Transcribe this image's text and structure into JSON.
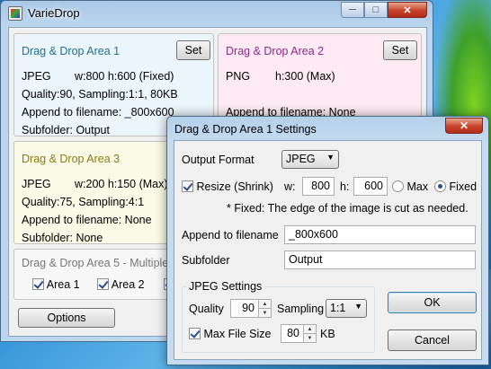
{
  "main_window": {
    "title": "VarieDrop",
    "caption": {
      "minimize": "─",
      "maximize": "□",
      "close": "✕"
    },
    "areas": {
      "area1": {
        "title": "Drag & Drop Area 1",
        "set_label": "Set",
        "format": "JPEG",
        "size": "w:800 h:600 (Fixed)",
        "quality": "Quality:90, Sampling:1:1, 80KB",
        "append": "Append to filename: _800x600",
        "subfolder": "Subfolder: Output"
      },
      "area2": {
        "title": "Drag & Drop Area 2",
        "set_label": "Set",
        "format": "PNG",
        "size": "h:300 (Max)",
        "append": "Append to filename: None"
      },
      "area3": {
        "title": "Drag & Drop Area 3",
        "format": "JPEG",
        "size": "w:200 h:150 (Max)",
        "quality": "Quality:75, Sampling:4:1",
        "append": "Append to filename: None",
        "subfolder": "Subfolder: None"
      },
      "area5": {
        "title": "Drag & Drop Area 5 - Multiple",
        "checks": [
          {
            "label": "Area 1",
            "checked": true
          },
          {
            "label": "Area 2",
            "checked": true
          },
          {
            "label": "",
            "checked": true
          }
        ]
      }
    },
    "options_label": "Options"
  },
  "dialog": {
    "title": "Drag & Drop Area 1 Settings",
    "close": "✕",
    "output_format_label": "Output Format",
    "output_format_value": "JPEG",
    "resize_label": "Resize (Shrink)",
    "resize_checked": true,
    "w_label": "w:",
    "w_value": "800",
    "h_label": "h:",
    "h_value": "600",
    "max_label": "Max",
    "fixed_label": "Fixed",
    "fixed_note": "* Fixed: The edge of the image is cut as needed.",
    "append_label": "Append to filename",
    "append_value": "_800x600",
    "subfolder_label": "Subfolder",
    "subfolder_value": "Output",
    "jpeg_group_title": "JPEG Settings",
    "quality_label": "Quality",
    "quality_value": "90",
    "sampling_label": "Sampling",
    "sampling_value": "1:1",
    "max_file_size_label": "Max File Size",
    "max_file_size_checked": true,
    "max_file_size_value": "80",
    "kb_label": "KB",
    "ok_label": "OK",
    "cancel_label": "Cancel"
  }
}
